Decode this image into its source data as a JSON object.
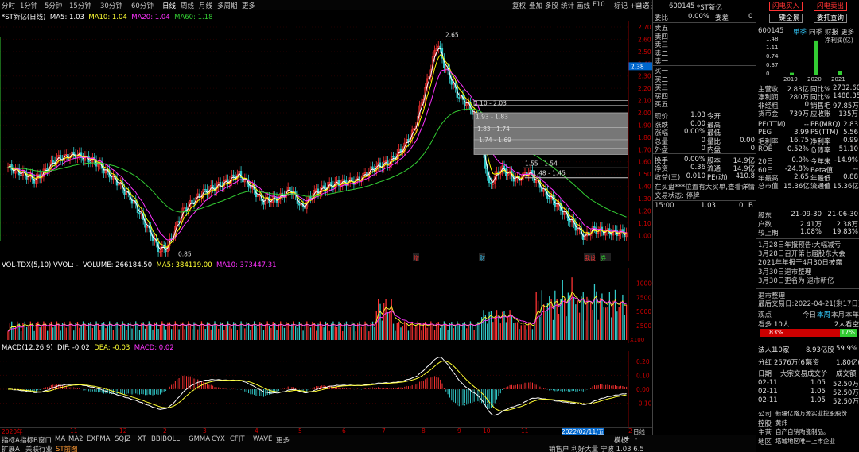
{
  "toolbar": {
    "periods": [
      "分时",
      "1分钟",
      "5分钟",
      "15分钟",
      "30分钟",
      "60分钟",
      "日线",
      "周线",
      "月线",
      "多周期",
      "更多"
    ],
    "active": "日线",
    "tools": [
      "叠加",
      "多股",
      "统计",
      "画线",
      "F10",
      "标记",
      "+自选",
      "返回"
    ],
    "first_tool": "复权",
    "window_icons": [
      "□",
      "×"
    ]
  },
  "stock": {
    "code": "600145",
    "name": "*ST新亿",
    "name_tag": "*ST新亿(日线)"
  },
  "ma": {
    "ma5": "MA5: 1.03",
    "ma10": "MA10: 1.04",
    "ma20": "MA20: 1.04",
    "ma60": "MA60: 1.18"
  },
  "colors": {
    "ma5": "#ffffff",
    "ma10": "#ffff00",
    "ma20": "#ff33ff",
    "ma60": "#33cc33",
    "up": "#ff3333",
    "down": "#33cccc"
  },
  "price_axis": [
    "2.70",
    "2.60",
    "2.50",
    "2.40",
    "2.30",
    "2.20",
    "2.10",
    "2.00",
    "1.90",
    "1.80",
    "1.70",
    "1.60",
    "1.50",
    "1.40",
    "1.30",
    "1.20",
    "1.10",
    "1.00"
  ],
  "price_current": "2.38",
  "price_annotations": {
    "high": "2.65",
    "low": "0.85",
    "gap1": "2.10 - 2.03",
    "gap2": "1.93 - 1.83",
    "gap3": "1.83 - 1.74",
    "gap4": "1.74 - 1.69",
    "gap5": "1.55 - 1.54",
    "gap6": "1.48 - 1.45"
  },
  "event_markers": [
    "增",
    "财",
    "我设",
    "券"
  ],
  "vol": {
    "title": "VOL-TDX(5,10) VVOL: -",
    "volume": "VOLUME: 266184.50",
    "ma5": "MA5: 384119.00",
    "ma10": "MA10: 373447.31",
    "axis": [
      "10000",
      "7500",
      "5000",
      "2500"
    ],
    "unit": "X100"
  },
  "macd": {
    "title": "MACD(12,26,9)",
    "dif": "DIF: -0.02",
    "dea": "DEA: -0.03",
    "macd": "MACD: 0.02",
    "axis": [
      "0.20",
      "0.10",
      "0.00",
      "-0.10"
    ]
  },
  "time_axis": [
    "2020年",
    "11",
    "12",
    "2",
    "3",
    "4",
    "5",
    "6",
    "7",
    "8",
    "9",
    "10",
    "11",
    "12",
    "2",
    "3"
  ],
  "time_cursor": "2022/02/11/五",
  "time_unit": "日线",
  "indicator_tabs": [
    "指标A",
    "指标B",
    "窗口",
    "MA",
    "MA2",
    "EXPMA",
    "SQJZ",
    "XT",
    "BBIBOLL",
    "GMMA",
    "CYX",
    "CFJT",
    "WAVE",
    "更多"
  ],
  "bottom_nav": [
    "扩展A",
    "关联行业",
    "ST前图"
  ],
  "bottom_right": [
    "模板",
    "+",
    "-"
  ],
  "bottom_status": "销售户 利好大量 宁波 1.03 6.5",
  "quote": {
    "weibi_label": "委比",
    "weibi": "0.00%",
    "weicha_label": "委差",
    "weicha": "0",
    "sell": [
      "卖五",
      "卖四",
      "卖三",
      "卖二",
      "卖一"
    ],
    "buy": [
      "买一",
      "买二",
      "买三",
      "买四",
      "买五"
    ],
    "rows": [
      [
        "现价",
        "1.03",
        "今开",
        ""
      ],
      [
        "涨跌",
        "0.00",
        "最高",
        ""
      ],
      [
        "涨幅",
        "0.00%",
        "最低",
        ""
      ],
      [
        "总量",
        "0",
        "量比",
        "0.00"
      ],
      [
        "外盘",
        "0",
        "内盘",
        "0"
      ],
      [
        "换手",
        "0.00%",
        "股本",
        "14.9亿"
      ],
      [
        "净资",
        "0.36",
        "流通",
        "14.9亿"
      ],
      [
        "收益(三)",
        "0.010",
        "PE(动)",
        "410.8"
      ]
    ],
    "notice": "在买盘***位置有大买单,查看详情",
    "status": "交易状态: 停牌",
    "tick_time": "15:00",
    "tick_price": "1.03",
    "tick_vol": "0",
    "tick_flag": "B"
  },
  "right": {
    "buttons": [
      "闪电买入",
      "闪电卖出",
      "一键全景",
      "委托查询"
    ],
    "code": "600145",
    "tabs": [
      "单季",
      "同季",
      "财报",
      "更多"
    ],
    "chart_title": "净利润(亿)",
    "chart_axis": [
      "1.48",
      "1.11",
      "0.74",
      "0.37",
      "0"
    ],
    "chart_years": [
      "2019",
      "2020",
      "2021"
    ],
    "net_profit": [
      0.08,
      1.45,
      0.16
    ],
    "fin": [
      [
        "主营收",
        "2.83亿",
        "同比%",
        "2732.60"
      ],
      [
        "净利润",
        "280万",
        "同比%",
        "1488.35"
      ],
      [
        "非经粗",
        "0",
        "销售毛",
        "97.85万"
      ],
      [
        "货币金",
        "739万",
        "应收账",
        "135万"
      ],
      [
        "PE(TTM)",
        "--",
        "PB(MRQ)",
        "2.83"
      ],
      [
        "PEG",
        "3.99",
        "PS(TTM)",
        "5.56"
      ],
      [
        "毛利率",
        "16.75",
        "净利率",
        "0.99"
      ],
      [
        "ROE",
        "0.52%",
        "负债率",
        "51.10"
      ],
      [
        "20日",
        "0.0%",
        "今年来",
        "-14.9%"
      ],
      [
        "60日",
        "-24.8%",
        "Beta值",
        "--"
      ],
      [
        "年最高",
        "2.65",
        "年最低",
        "0.88"
      ],
      [
        "总市值",
        "15.36亿",
        "流通值",
        "15.36亿"
      ]
    ],
    "holders": [
      [
        "股东",
        "21-09-30",
        "21-06-30"
      ],
      [
        "户数",
        "2.41万",
        "2.38万"
      ],
      [
        "较上期",
        "1.08%",
        "19.83%"
      ]
    ],
    "news": [
      "1月28日年报预告:大幅减亏",
      "3月28日召开第七届股东大会",
      "2021年年报于4月30日披露",
      "3月30日退市整理",
      "3月30日更名为 退市新亿"
    ],
    "delist_title": "退市整理",
    "delist_date": "最后交易日:2022-04-21(剩17日)",
    "views": [
      "观点",
      "今日",
      "本周",
      "本月",
      "本年"
    ],
    "bull": "看多",
    "bull_count": "10人",
    "bear": "2人",
    "bear_label": "看空",
    "bull_pct": "83%",
    "bear_pct": "17%",
    "bull_share": 0.83,
    "fund": [
      "法人1",
      "10家",
      "8.93亿股",
      "59.9%"
    ],
    "dividend": [
      "分红",
      "2576万(6)",
      "募资",
      "1.80亿(1)"
    ],
    "deals_header": [
      "日期",
      "大宗交易成交价",
      "成交额"
    ],
    "deals": [
      [
        "02-11",
        "1.05",
        "52.50万"
      ],
      [
        "02-11",
        "1.05",
        "52.50万"
      ],
      [
        "02-11",
        "1.05",
        "52.50万"
      ]
    ],
    "company": [
      [
        "公司",
        "新疆亿路万源实业控股股份..."
      ],
      [
        "控股",
        "黄炜"
      ],
      [
        "主营",
        "自产自销陶瓷制品。"
      ],
      [
        "地区",
        "塔城地区唯一上市企业"
      ]
    ]
  }
}
